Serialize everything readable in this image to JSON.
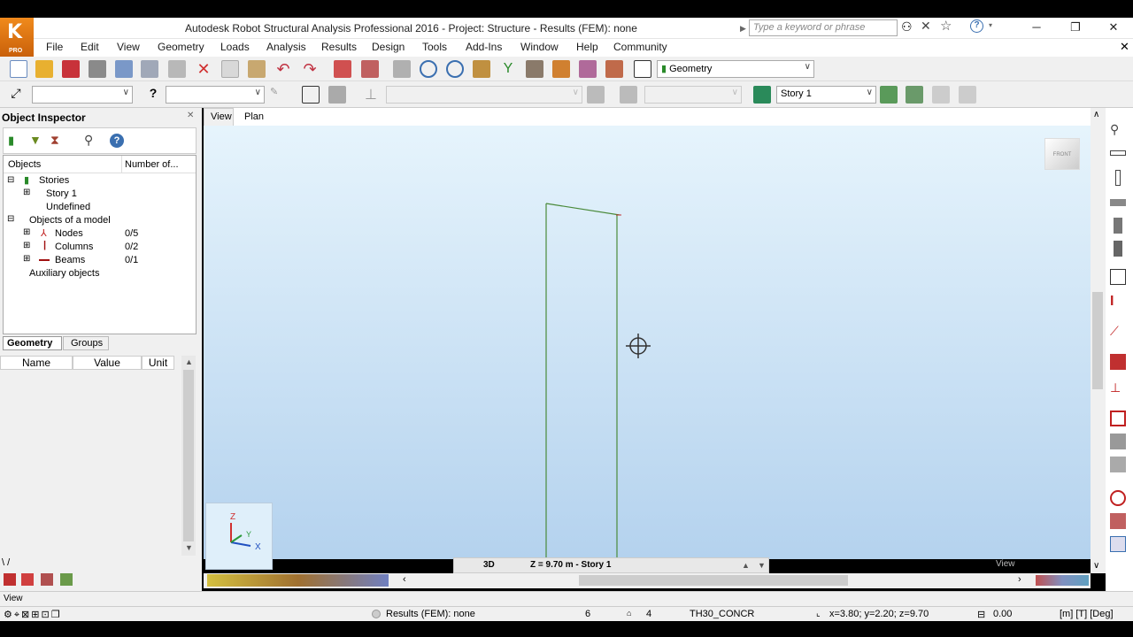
{
  "app": {
    "title": "Autodesk Robot Structural Analysis Professional 2016 - Project: Structure - Results (FEM): none",
    "logo_text": "PRO",
    "search_placeholder": "Type a keyword or phrase"
  },
  "menu": [
    "File",
    "Edit",
    "View",
    "Geometry",
    "Loads",
    "Analysis",
    "Results",
    "Design",
    "Tools",
    "Add-Ins",
    "Window",
    "Help",
    "Community"
  ],
  "toolbar": {
    "layout_select": "Geometry",
    "story_select": "Story 1"
  },
  "inspector": {
    "title": "Object Inspector",
    "col_objects": "Objects",
    "col_number": "Number of...",
    "tree": {
      "stories": "Stories",
      "story1": "Story 1",
      "undefined": "Undefined",
      "objects_of_model": "Objects of a model",
      "nodes": "Nodes",
      "nodes_count": "0/5",
      "columns": "Columns",
      "columns_count": "0/2",
      "beams": "Beams",
      "beams_count": "0/1",
      "auxiliary": "Auxiliary objects"
    },
    "tabs": {
      "geometry": "Geometry",
      "groups": "Groups"
    },
    "props": {
      "name": "Name",
      "value": "Value",
      "unit": "Unit"
    }
  },
  "view_tabs": {
    "view": "View",
    "plan": "Plan"
  },
  "viewport": {
    "mode": "3D",
    "level": "Z = 9.70 m - Story 1",
    "cube_label": "FRONT",
    "axis_z": "Z",
    "axis_y": "Y",
    "axis_x": "X",
    "watermark": "View"
  },
  "bottom_left_label": "View",
  "status": {
    "results": "Results (FEM): none",
    "count1": "6",
    "count2": "4",
    "section": "TH30_CONCR",
    "coords": "x=3.80; y=2.20; z=9.70",
    "angle": "0.00",
    "units": "[m] [T] [Deg]"
  },
  "colors": {
    "accent": "#f08a1c",
    "model_line": "#4a8a3a"
  }
}
